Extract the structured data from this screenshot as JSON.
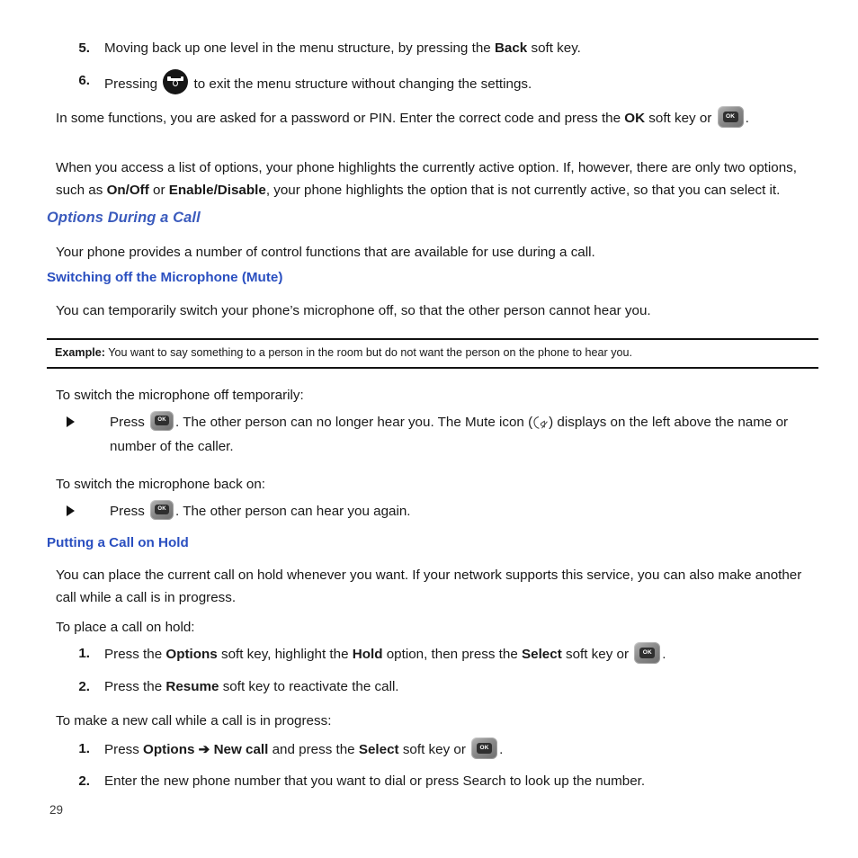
{
  "document": {
    "page_number": "29",
    "accent_heading_color": "#3b5bbd",
    "accent_subheading_color": "#2a4fc0",
    "body_text_color": "#181818"
  },
  "steps_top": [
    {
      "number": "5.",
      "pre": "Moving back up one level in the menu structure, by pressing the ",
      "bold": "Back",
      "post": " soft key."
    },
    {
      "number": "6.",
      "pre": "Pressing ",
      "icon": "end-call-key-icon",
      "post": " to exit the menu structure without changing the settings."
    }
  ],
  "para_password": {
    "pre": "In some functions, you are asked for a password or PIN. Enter the correct code and press the ",
    "bold": "OK",
    "mid": " soft key or ",
    "icon": "ok-key-icon",
    "post": "."
  },
  "para_options_list": {
    "pre": "When you access a list of options, your phone highlights the currently active option. If, however, there are only two options, such as ",
    "bold1": "On/Off",
    "mid": " or ",
    "bold2": "Enable/Disable",
    "post": ", your phone highlights the option that is not currently active, so that you can select it."
  },
  "section_heading": "Options During a Call",
  "para_control_functions": "Your phone provides a number of control functions that are available for use during a call.",
  "subheading_mute": "Switching off the Microphone (Mute)",
  "para_mute_intro": "You can temporarily switch your phone’s microphone off, so that the other person cannot hear you.",
  "example": {
    "label": "Example:",
    "text": " You want to say something to a person in the room but do not want the person on the phone to hear you."
  },
  "lead_mic_off": "To switch the microphone off temporarily:",
  "bullet_mic_off": {
    "pre": "Press ",
    "icon": "ok-key-icon",
    "mid": ". The other person can no longer hear you. The Mute icon (",
    "mute_icon": "mute-icon",
    "post": ") displays on the left above the name or number of the caller."
  },
  "lead_mic_on": "To switch the microphone back on:",
  "bullet_mic_on": {
    "pre": "Press ",
    "icon": "ok-key-icon",
    "post": ". The other person can hear you again."
  },
  "subheading_hold": "Putting a Call on Hold",
  "para_hold_intro": "You can place the current call on hold whenever you want. If your network supports this service, you can also make another call while a call is in progress.",
  "lead_place_hold": "To place a call on hold:",
  "steps_hold": [
    {
      "number": "1.",
      "pre": "Press the ",
      "bold1": "Options",
      "mid1": " soft key, highlight the ",
      "bold2": "Hold",
      "mid2": " option, then press the ",
      "bold3": "Select",
      "mid3": " soft key or ",
      "icon": "ok-key-icon",
      "post": "."
    },
    {
      "number": "2.",
      "pre": "Press the ",
      "bold1": "Resume",
      "post": " soft key to reactivate the call."
    }
  ],
  "lead_new_call": "To make a new call while a call is in progress:",
  "steps_new_call": [
    {
      "number": "1.",
      "pre": "Press ",
      "bold1": "Options",
      "arrow": " ➔ ",
      "bold2": "New call",
      "mid1": " and press the ",
      "bold3": "Select",
      "mid2": " soft key or ",
      "icon": "ok-key-icon",
      "post": "."
    },
    {
      "number": "2.",
      "pre": "Enter the new phone number that you want to dial or press Search to look up the number.",
      "post": ""
    }
  ]
}
